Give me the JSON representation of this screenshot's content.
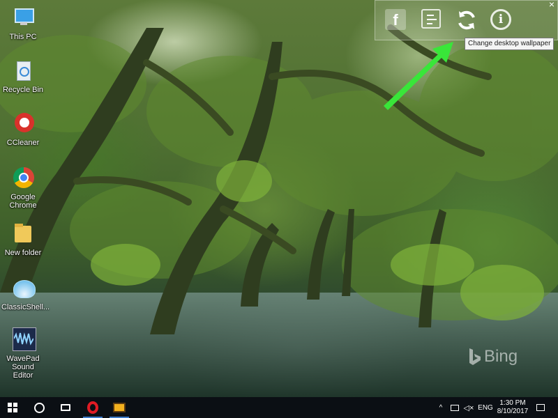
{
  "desktop": {
    "icons": [
      {
        "label": "This PC",
        "icon": "this-pc-icon"
      },
      {
        "label": "Recycle Bin",
        "icon": "recycle-bin-icon"
      },
      {
        "label": "CCleaner",
        "icon": "ccleaner-icon"
      },
      {
        "label": "Google Chrome",
        "icon": "chrome-icon"
      },
      {
        "label": "New folder",
        "icon": "folder-icon"
      },
      {
        "label": "ClassicShell...",
        "icon": "classicshell-icon"
      },
      {
        "label": "WavePad Sound Editor",
        "icon": "wavepad-icon"
      }
    ],
    "watermark": "Bing"
  },
  "wallpaper_toolbar": {
    "buttons": [
      "facebook-icon",
      "wallpaper-info-icon",
      "refresh-icon",
      "info-icon"
    ],
    "close_glyph": "×",
    "tooltip": "Change desktop wallpaper",
    "arrow_color": "#39e639"
  },
  "taskbar": {
    "language": "ENG",
    "time": "1:30 PM",
    "date": "8/10/2017",
    "pinned": [
      "opera-icon",
      "photos-app-icon"
    ]
  },
  "colors": {
    "taskbar": "#0b0f14",
    "accent": "#3d7ac8"
  }
}
